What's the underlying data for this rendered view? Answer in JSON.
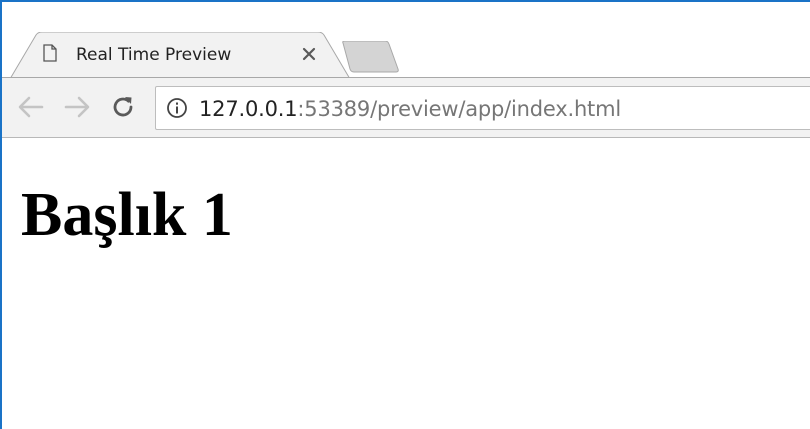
{
  "tab": {
    "title": "Real Time Preview",
    "icon": "page-icon",
    "close_icon": "close-icon"
  },
  "toolbar": {
    "back_icon": "arrow-left-icon",
    "forward_icon": "arrow-right-icon",
    "reload_icon": "reload-icon",
    "info_icon": "info-icon",
    "url_host": "127.0.0.1",
    "url_rest": ":53389/preview/app/index.html"
  },
  "page": {
    "heading": "Başlık 1"
  },
  "colors": {
    "frame_accent": "#1a73c7",
    "toolbar_bg": "#f2f2f2",
    "url_host": "#222222",
    "url_rest": "#767676"
  }
}
